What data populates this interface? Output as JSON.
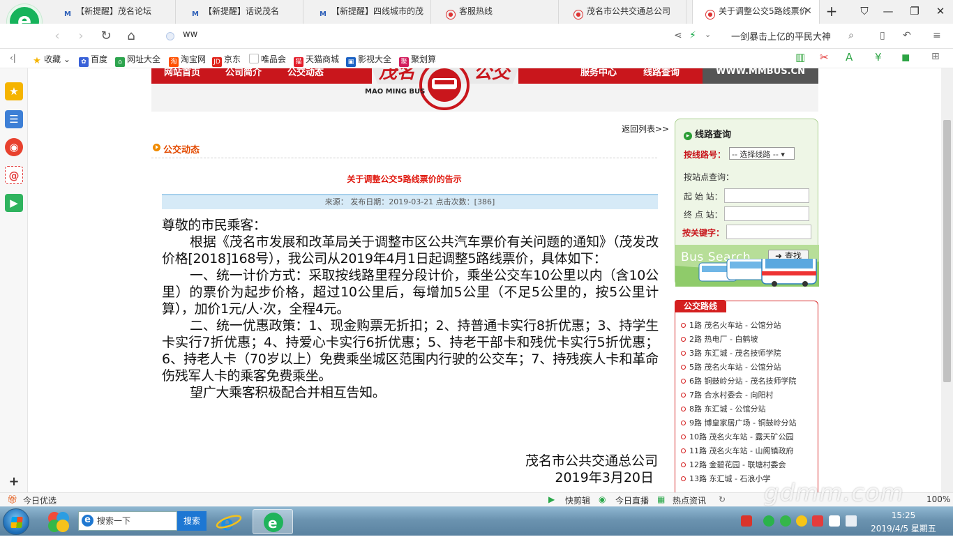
{
  "browser": {
    "tabs": [
      {
        "label": "【新提醒】茂名论坛",
        "icon": "m-logo-icon"
      },
      {
        "label": "【新提醒】话说茂名",
        "icon": "m-logo-icon"
      },
      {
        "label": "【新提醒】四线城市的茂",
        "icon": "m-logo-icon"
      },
      {
        "label": "客服热线",
        "icon": "bus-logo-icon"
      },
      {
        "label": "茂名市公共交通总公司",
        "icon": "bus-logo-icon"
      },
      {
        "label": "关于调整公交5路线票价",
        "icon": "bus-logo-icon",
        "active": true
      }
    ],
    "new_tab": "+",
    "address": "ww",
    "search_text": "一剑暴击上亿的平民大神",
    "bookmarks": [
      "收藏",
      "百度",
      "网址大全",
      "淘宝网",
      "京东",
      "唯品会",
      "天猫商城",
      "影视大全",
      "聚划算"
    ],
    "status": {
      "left": "今日优选",
      "items": [
        "快剪辑",
        "今日直播",
        "热点资讯"
      ],
      "zoom": "100%"
    }
  },
  "site": {
    "nav_left": [
      "网站首页",
      "公司简介",
      "公交动态"
    ],
    "nav_right": [
      "服务中心",
      "线路查询"
    ],
    "logo_sub": "MAO MING BUS",
    "url_badge": "WWW.MMBUS.CN"
  },
  "page": {
    "return_link": "返回列表>>",
    "section": "公交动态",
    "title": "关于调整公交5路线票价的告示",
    "meta": "来源：  发布日期：2019-03-21 点击次数：[386]",
    "paragraphs": [
      "尊敬的市民乘客：",
      "根据《茂名市发展和改革局关于调整市区公共汽车票价有关问题的通知》（茂发改价格[2018]168号），我公司从2019年4月1日起调整5路线票价，具体如下：",
      "一、统一计价方式：采取按线路里程分段计价，乘坐公交车10公里以内（含10公里）的票价为起步价格，超过10公里后，每增加5公里（不足5公里的，按5公里计算），加价1元/人·次，全程4元。",
      "二、统一优惠政策：1、现金购票无折扣；2、持普通卡实行8折优惠；3、持学生卡实行7折优惠；4、持爱心卡实行6折优惠；5、持老干部卡和残优卡实行5折优惠；6、持老人卡（70岁以上）免费乘坐城区范围内行驶的公交车；7、持残疾人卡和革命伤残军人卡的乘客免费乘坐。",
      "望广大乘客积极配合并相互告知。"
    ],
    "sign_org": "茂名市公共交通总公司",
    "sign_date": "2019年3月20日"
  },
  "route_query": {
    "title": "线路查询",
    "by_line_label": "按线路号：",
    "select_value": "-- 选择线路 --",
    "by_stop_label": "按站点查询：",
    "start_label": "起 始 站：",
    "end_label": "终 点 站：",
    "keyword_label": "按关键字：",
    "bus_search": "Bus Search",
    "search_btn": "查找"
  },
  "bus_lines": {
    "title": "公交路线",
    "items": [
      "1路 茂名火车站 - 公馆分站",
      "2路 热电厂 - 白鹤坡",
      "3路 东汇城 - 茂名技师学院",
      "5路 茂名火车站 - 公馆分站",
      "6路 铜鼓岭分站 - 茂名技师学院",
      "7路 合水村委会 - 向阳村",
      "8路 东汇城 - 公馆分站",
      "9路 博皇家居广场 - 铜鼓岭分站",
      "10路 茂名火车站 - 露天矿公园",
      "11路 茂名火车站 - 山阁镇政府",
      "12路 金碧花园 - 联塘村委会",
      "13路 东汇城 - 石浪小学"
    ]
  },
  "watermark": "gdmm.com",
  "taskbar": {
    "search_placeholder": "搜索一下",
    "search_btn": "搜索",
    "time": "15:25",
    "date": "2019/4/5 星期五"
  }
}
